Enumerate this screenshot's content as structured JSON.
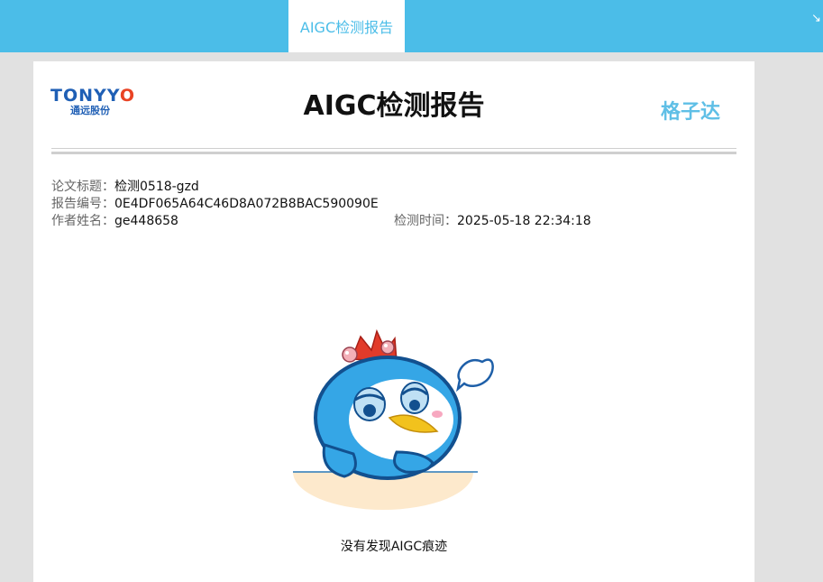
{
  "header": {
    "active_tab": "AIGC检测报告",
    "collapse_icon": "collapse-arrow-icon"
  },
  "report": {
    "left_logo": {
      "brand": "TONYYO",
      "sub": "通远股份"
    },
    "title": "AIGC检测报告",
    "right_logo": "格子达",
    "fields": {
      "paper_title_label": "论文标题：",
      "paper_title_value": "检测0518-gzd",
      "report_id_label": "报告编号：",
      "report_id_value": "0E4DF065A64C46D8A072B8BAC590090E",
      "author_label": "作者姓名：",
      "author_value": "ge448658",
      "time_label": "检测时间：",
      "time_value": "2025-05-18 22:34:18"
    },
    "mascot": "sad-penguin-mascot",
    "result_text": "没有发现AIGC痕迹"
  }
}
